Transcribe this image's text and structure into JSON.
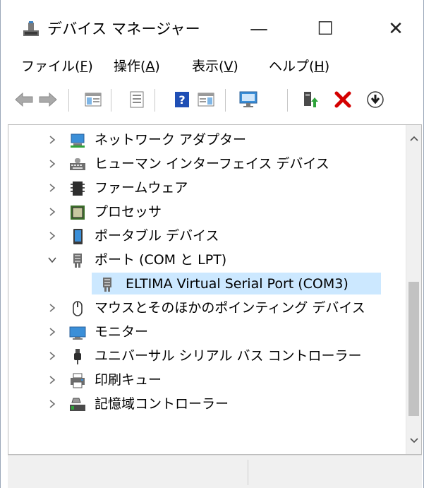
{
  "window": {
    "title": "デバイス マネージャー",
    "minimize_glyph": "—",
    "maximize_glyph": "☐",
    "close_glyph": "✕"
  },
  "menu": [
    {
      "prefix": "ファイル(",
      "key": "F",
      "suffix": ")"
    },
    {
      "prefix": "操作(",
      "key": "A",
      "suffix": ")"
    },
    {
      "prefix": "表示(",
      "key": "V",
      "suffix": ")"
    },
    {
      "prefix": "ヘルプ(",
      "key": "H",
      "suffix": ")"
    }
  ],
  "toolbar": {
    "icons": [
      "back-arrow-icon",
      "forward-arrow-icon",
      "show-hide-console-tree-icon",
      "properties-icon",
      "help-icon",
      "action-pane-icon",
      "scan-hardware-icon",
      "update-driver-icon",
      "uninstall-device-icon",
      "disable-device-icon"
    ]
  },
  "tree": {
    "items": [
      {
        "label": "ネットワーク アダプター",
        "expanded": false,
        "icon": "network-adapter-icon"
      },
      {
        "label": "ヒューマン インターフェイス デバイス",
        "expanded": false,
        "icon": "hid-icon"
      },
      {
        "label": "ファームウェア",
        "expanded": false,
        "icon": "firmware-icon"
      },
      {
        "label": "プロセッサ",
        "expanded": false,
        "icon": "processor-icon"
      },
      {
        "label": "ポータブル デバイス",
        "expanded": false,
        "icon": "portable-device-icon"
      },
      {
        "label": "ポート (COM と LPT)",
        "expanded": true,
        "icon": "port-icon"
      },
      {
        "label": "ELTIMA Virtual Serial Port (COM3)",
        "child": true,
        "selected": true,
        "icon": "port-icon"
      },
      {
        "label": "マウスとそのほかのポインティング デバイス",
        "expanded": false,
        "icon": "mouse-icon"
      },
      {
        "label": "モニター",
        "expanded": false,
        "icon": "monitor-icon"
      },
      {
        "label": "ユニバーサル シリアル バス コントローラー",
        "expanded": false,
        "icon": "usb-icon"
      },
      {
        "label": "印刷キュー",
        "expanded": false,
        "icon": "print-queue-icon"
      },
      {
        "label": "記憶域コントローラー",
        "expanded": false,
        "icon": "storage-controller-icon"
      }
    ]
  },
  "colors": {
    "selection": "#cce8ff",
    "uninstall_red": "#d40000",
    "help_blue": "#1f4fb5"
  }
}
